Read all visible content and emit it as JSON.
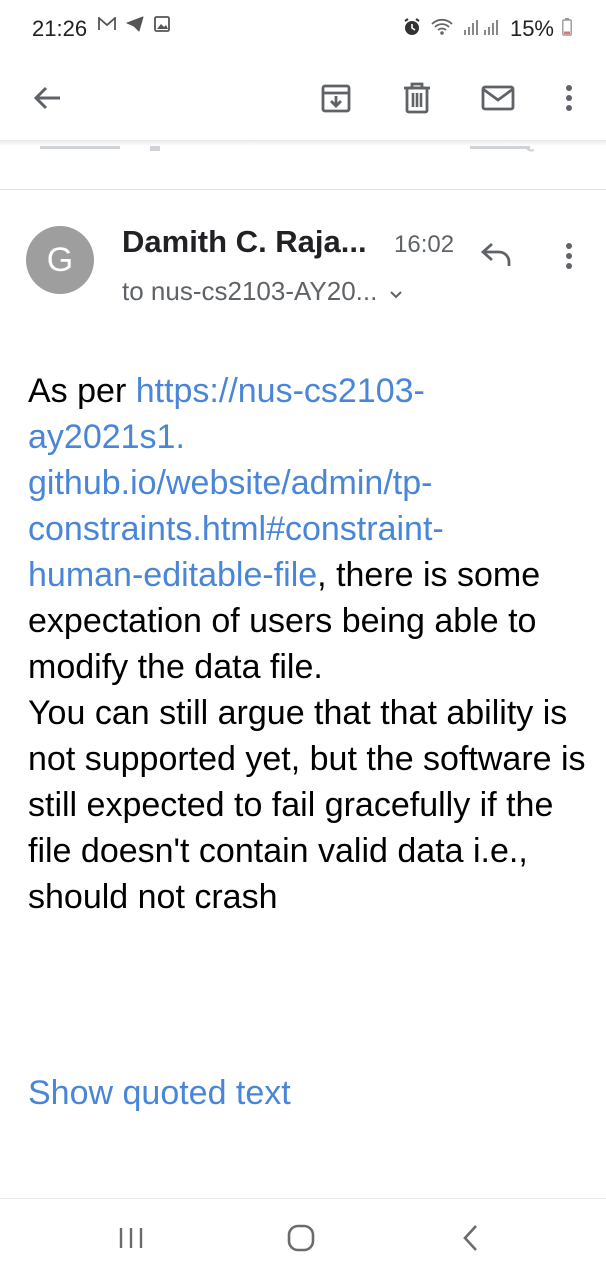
{
  "status_bar": {
    "time": "21:26",
    "battery": "15%",
    "left_icons": [
      "gmail-icon",
      "telegram-icon",
      "gallery-icon"
    ],
    "right_icons": [
      "alarm-icon",
      "wifi-icon",
      "signal-icon"
    ]
  },
  "toolbar": {
    "icons": [
      "back-arrow-icon",
      "archive-icon",
      "delete-icon",
      "mark-unread-icon",
      "more-vert-icon"
    ]
  },
  "message": {
    "avatar_letter": "G",
    "avatar_color": "#9e9e9e",
    "sender": "Damith C. Raja...",
    "time": "16:02",
    "recipient": "to nus-cs2103-AY20...",
    "body": {
      "prefix": "As per ",
      "link": "https://nus-cs2103-ay2021s1.github.io/website/admin/tp-constraints.html#constraint-human-editable-file",
      "link_lines": [
        "https://nus-cs2103-",
        "ay2021s1.",
        "github.io/website/admin/tp-",
        "constraints.html#constraint-",
        "human-editable-file"
      ],
      "rest": ", there is some expectation of users being able to modify the data file.",
      "paragraph2": "You can still argue that that ability is not supported yet, but the software is still expected to fail gracefully if the file doesn't contain valid data i.e., should not crash"
    },
    "show_quoted": "Show quoted text"
  },
  "colors": {
    "link": "#4a86d8",
    "icon": "#5f6368"
  },
  "nav_bar": {
    "icons": [
      "recents-icon",
      "home-icon",
      "back-icon"
    ]
  }
}
